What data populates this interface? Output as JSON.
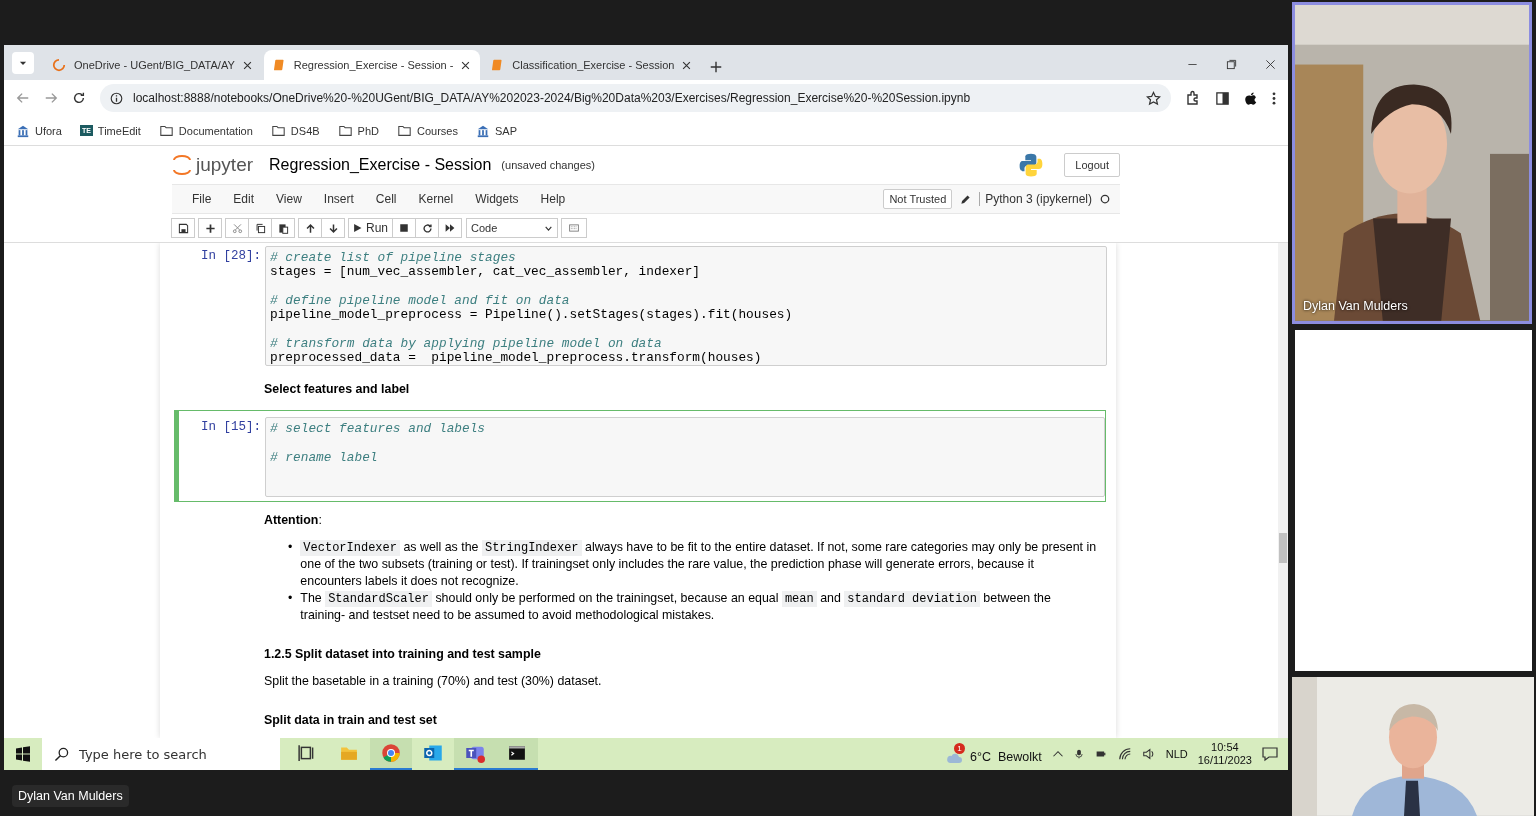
{
  "browser": {
    "tabs": [
      {
        "title": "OneDrive - UGent/BIG_DATA/AY",
        "kind": "onedrive",
        "selected": false
      },
      {
        "title": "Regression_Exercise - Session -",
        "kind": "notebook",
        "selected": true
      },
      {
        "title": "Classification_Exercise - Session",
        "kind": "notebook",
        "selected": false
      }
    ],
    "url": "localhost:8888/notebooks/OneDrive%20-%20UGent/BIG_DATA/AY%202023-2024/Big%20Data%203/Exercises/Regression_Exercise%20-%20Session.ipynb",
    "bookmarks": [
      {
        "label": "Ufora",
        "kind": "site"
      },
      {
        "label": "TimeEdit",
        "kind": "badge",
        "badge": "TE"
      },
      {
        "label": "Documentation",
        "kind": "folder"
      },
      {
        "label": "DS4B",
        "kind": "folder"
      },
      {
        "label": "PhD",
        "kind": "folder"
      },
      {
        "label": "Courses",
        "kind": "folder"
      },
      {
        "label": "SAP",
        "kind": "site"
      }
    ]
  },
  "jupyter": {
    "logo_text": "jupyter",
    "title": "Regression_Exercise - Session",
    "save_status": "(unsaved changes)",
    "logout": "Logout",
    "menu": [
      "File",
      "Edit",
      "View",
      "Insert",
      "Cell",
      "Kernel",
      "Widgets",
      "Help"
    ],
    "trust": "Not Trusted",
    "kernel": "Python 3 (ipykernel)",
    "run_label": "Run",
    "cell_type": "Code",
    "cells": [
      {
        "kind": "code",
        "prompt": "In [28]:",
        "selected": false,
        "blocks": [
          [
            {
              "kind": "comment",
              "text": "# create list of pipeline stages"
            },
            {
              "kind": "code",
              "text": "stages = [num_vec_assembler, cat_vec_assembler, indexer]"
            }
          ],
          [
            {
              "kind": "comment",
              "text": "# define pipeline model and fit on data"
            },
            {
              "kind": "code",
              "text": "pipeline_model_preprocess = Pipeline().setStages(stages).fit(houses)"
            }
          ],
          [
            {
              "kind": "comment",
              "text": "# transform data by applying pipeline model on data"
            },
            {
              "kind": "code",
              "text": "preprocessed_data =  pipeline_model_preprocess.transform(houses)"
            }
          ]
        ]
      },
      {
        "kind": "bold_text",
        "text": "Select features and label"
      },
      {
        "kind": "code",
        "prompt": "In [15]:",
        "selected": true,
        "blocks": [
          [
            {
              "kind": "comment",
              "text": "# select features and labels"
            }
          ],
          [
            {
              "kind": "comment",
              "text": "# rename label"
            }
          ]
        ]
      },
      {
        "kind": "paragraph",
        "text": "**Attention**:"
      },
      {
        "kind": "bullets",
        "items": [
          {
            "marker": "•",
            "parts": [
              {
                "kind": "code",
                "text": "VectorIndexer"
              },
              {
                "kind": "text",
                "text": " as well as the "
              },
              {
                "kind": "code",
                "text": "StringIndexer"
              },
              {
                "kind": "text",
                "text": " always have to be fit to the entire dataset. If not, some rare categories may only be present in one of the two subsets (training or test). If trainingset only includes the rare value, the prediction phase will generate errors, because it encounters labels it does not recognize."
              }
            ]
          },
          {
            "marker": "•",
            "parts": [
              {
                "kind": "text",
                "text": "The "
              },
              {
                "kind": "code",
                "text": "StandardScaler"
              },
              {
                "kind": "text",
                "text": " should only be performed on the trainingset, because an equal "
              },
              {
                "kind": "code",
                "text": "mean"
              },
              {
                "kind": "text",
                "text": " and "
              },
              {
                "kind": "code",
                "text": "standard deviation"
              },
              {
                "kind": "text",
                "text": " between the training- and testset need to be assumed to avoid methodological mistakes."
              }
            ]
          }
        ]
      },
      {
        "kind": "heading",
        "text": "1.2.5 Split dataset into training and test sample"
      },
      {
        "kind": "paragraph",
        "text": "Split the basetable in a training (70%) and test (30%) dataset."
      },
      {
        "kind": "heading",
        "text": "Split data in train and test set"
      }
    ]
  },
  "taskbar": {
    "search_placeholder": "Type here to search",
    "apps": [
      {
        "kind": "taskview",
        "active": false
      },
      {
        "kind": "files",
        "active": false
      },
      {
        "kind": "chrome",
        "active": true
      },
      {
        "kind": "mail",
        "active": false
      },
      {
        "kind": "teams",
        "active": true
      },
      {
        "kind": "terminal",
        "active": true
      }
    ],
    "weather_badge": "1",
    "weather": "6°C  Bewolkt",
    "language": "NLD",
    "time": "10:54",
    "date": "16/11/2023"
  },
  "presenter_label": "Dylan Van Mulders",
  "tiles": [
    {
      "kind": "video",
      "name": "Dylan Van Mulders",
      "speaking": true
    },
    {
      "kind": "blank"
    },
    {
      "kind": "video",
      "speaking": false
    }
  ]
}
